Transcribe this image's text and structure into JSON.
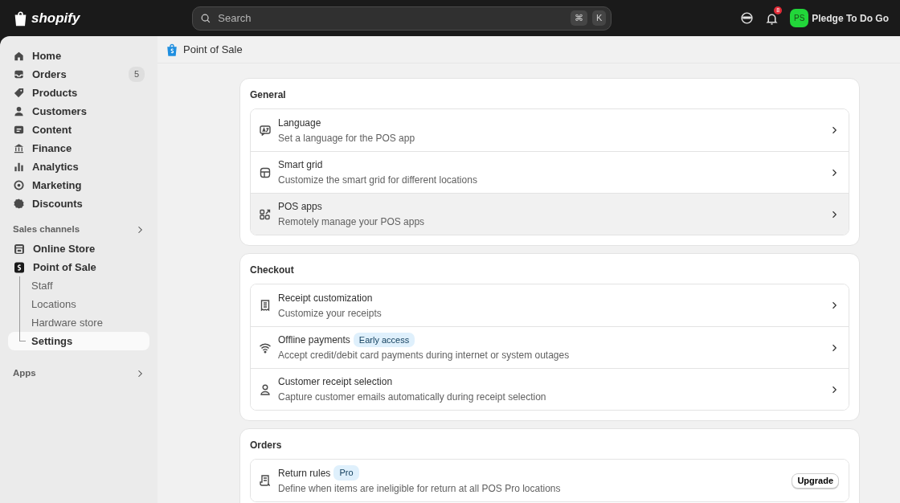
{
  "topbar": {
    "logo": "shopify",
    "search": {
      "placeholder": "Search"
    },
    "shortcut_keys": [
      "⌘",
      "K"
    ],
    "notification_count": "8",
    "store": {
      "initials": "PS",
      "name": "Pledge To Do Go"
    }
  },
  "sidebar": {
    "items": [
      {
        "label": "Home",
        "selected": false
      },
      {
        "label": "Orders",
        "selected": false,
        "badge": "5"
      },
      {
        "label": "Products",
        "selected": false
      },
      {
        "label": "Customers",
        "selected": false
      },
      {
        "label": "Content",
        "selected": false
      },
      {
        "label": "Finance",
        "selected": false
      },
      {
        "label": "Analytics",
        "selected": false
      },
      {
        "label": "Marketing",
        "selected": false
      },
      {
        "label": "Discounts",
        "selected": false
      }
    ],
    "sales_channels": {
      "label": "Sales channels",
      "items": [
        {
          "label": "Online Store",
          "selected": false
        },
        {
          "label": "Point of Sale",
          "selected": false,
          "children": [
            {
              "label": "Staff",
              "selected": false
            },
            {
              "label": "Locations",
              "selected": false
            },
            {
              "label": "Hardware store",
              "selected": false
            },
            {
              "label": "Settings",
              "selected": true
            }
          ]
        }
      ]
    },
    "apps": {
      "label": "Apps"
    }
  },
  "page": {
    "title": "Point of Sale",
    "sections": [
      {
        "title": "General",
        "rows": [
          {
            "title": "Language",
            "description": "Set a language for the POS app",
            "highlighted": false
          },
          {
            "title": "Smart grid",
            "description": "Customize the smart grid for different locations",
            "highlighted": false
          },
          {
            "title": "POS apps",
            "description": "Remotely manage your POS apps",
            "highlighted": true
          }
        ]
      },
      {
        "title": "Checkout",
        "rows": [
          {
            "title": "Receipt customization",
            "description": "Customize your receipts",
            "highlighted": false
          },
          {
            "title": "Offline payments",
            "badge": "Early access",
            "description": "Accept credit/debit card payments during internet or system outages",
            "highlighted": false
          },
          {
            "title": "Customer receipt selection",
            "description": "Capture customer emails automatically during receipt selection",
            "highlighted": false
          }
        ]
      },
      {
        "title": "Orders",
        "rows": [
          {
            "title": "Return rules",
            "badge": "Pro",
            "description": "Define when items are ineligible for return at all POS Pro locations",
            "highlighted": false,
            "action": "Upgrade"
          }
        ]
      }
    ]
  }
}
